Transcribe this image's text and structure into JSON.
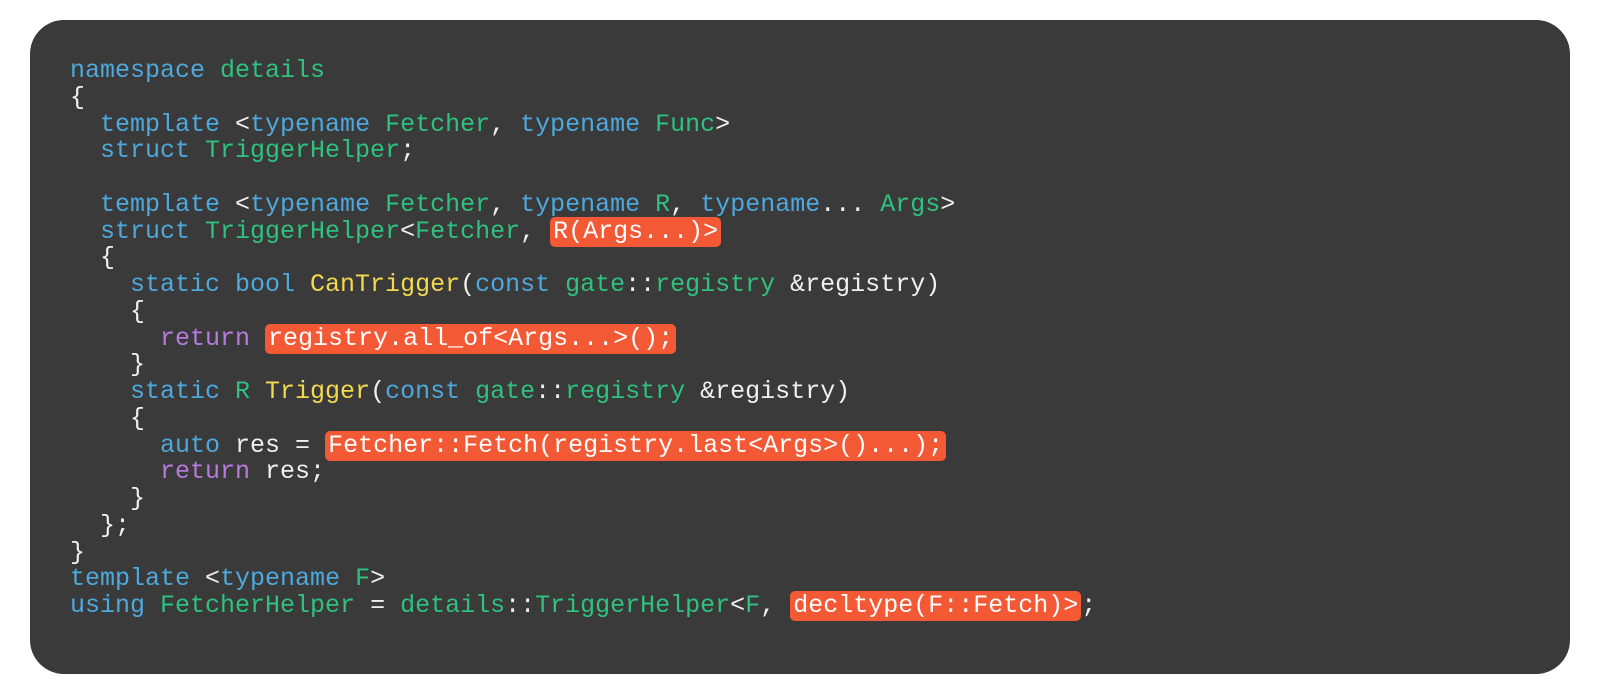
{
  "code": {
    "l1_namespace": "namespace",
    "l1_details": "details",
    "l2_brace": "{",
    "l3_template": "  template",
    "l3_open": " <",
    "l3_typename1": "typename",
    "l3_Fetcher": " Fetcher",
    "l3_comma": ", ",
    "l3_typename2": "typename",
    "l3_Func": " Func",
    "l3_close": ">",
    "l4_struct": "  struct",
    "l4_TriggerHelper": " TriggerHelper",
    "l4_semi": ";",
    "l6_template": "  template",
    "l6_open": " <",
    "l6_typename1": "typename",
    "l6_Fetcher": " Fetcher",
    "l6_comma1": ", ",
    "l6_typename2": "typename",
    "l6_R": " R",
    "l6_comma2": ", ",
    "l6_typename3": "typename",
    "l6_dots": "...",
    "l6_Args": " Args",
    "l6_close": ">",
    "l7_struct": "  struct",
    "l7_TriggerHelper": " TriggerHelper",
    "l7_open": "<",
    "l7_Fetcher": "Fetcher",
    "l7_comma": ", ",
    "l7_hl": "R(Args...)>",
    "l8_brace": "  {",
    "l9_static": "    static",
    "l9_bool": " bool",
    "l9_CanTrigger": " CanTrigger",
    "l9_paren": "(",
    "l9_const": "const",
    "l9_gate": " gate",
    "l9_col": "::",
    "l9_registry": "registry",
    "l9_amp": " &registry)",
    "l10_brace": "    {",
    "l11_return": "      return",
    "l11_sp": " ",
    "l11_hl": "registry.all_of<Args...>();",
    "l12_brace": "    }",
    "l13_static": "    static",
    "l13_R": " R",
    "l13_Trigger": " Trigger",
    "l13_paren": "(",
    "l13_const": "const",
    "l13_gate": " gate",
    "l13_col": "::",
    "l13_registry": "registry",
    "l13_amp": " &registry)",
    "l14_brace": "    {",
    "l15_auto": "      auto",
    "l15_res": " res = ",
    "l15_hl": "Fetcher::Fetch(registry.last<Args>()...);",
    "l16_return": "      return",
    "l16_res": " res;",
    "l17_brace": "    }",
    "l18_close": "  };",
    "l19_brace": "}",
    "l20_template": "template",
    "l20_open": " <",
    "l20_typename": "typename",
    "l20_F": " F",
    "l20_close": ">",
    "l21_using": "using",
    "l21_FetcherHelper": " FetcherHelper",
    "l21_eq": " = ",
    "l21_details": "details",
    "l21_col": "::",
    "l21_TriggerHelper": "TriggerHelper",
    "l21_open": "<",
    "l21_F": "F",
    "l21_comma": ", ",
    "l21_hl": "decltype(F::Fetch)>",
    "l21_semi": ";"
  }
}
